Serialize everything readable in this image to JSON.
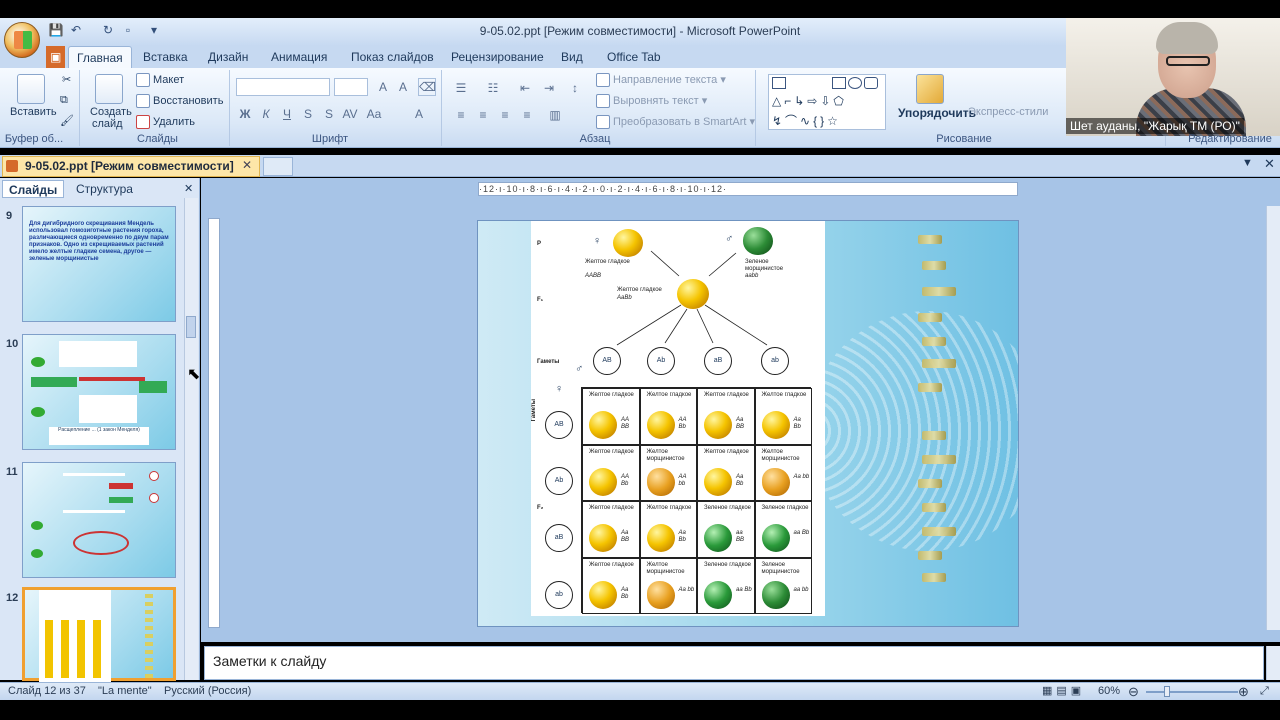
{
  "window": {
    "title": "9-05.02.ppt [Режим совместимости] - Microsoft PowerPoint"
  },
  "ribbon_tabs": [
    "Главная",
    "Вставка",
    "Дизайн",
    "Анимация",
    "Показ слайдов",
    "Рецензирование",
    "Вид",
    "Office Tab"
  ],
  "clipboard": {
    "paste": "Вставить",
    "label": "Буфер об..."
  },
  "slides_group": {
    "create": "Создать",
    "create2": "слайд",
    "layout": "Макет",
    "reset": "Восстановить",
    "delete": "Удалить",
    "label": "Слайды"
  },
  "font_group": {
    "label": "Шрифт"
  },
  "paragraph_group": {
    "direction": "Направление текста",
    "align": "Выровнять текст",
    "smartart": "Преобразовать в SmartArt",
    "label": "Абзац"
  },
  "drawing_group": {
    "arrange": "Упорядочить",
    "styles": "Экспресс-стили",
    "label": "Рисование"
  },
  "editing_group": {
    "label": "Редактирование"
  },
  "doc_tab": {
    "label": "9-05.02.ppt [Режим совместимости]"
  },
  "pane_tabs": {
    "slides": "Слайды",
    "outline": "Структура"
  },
  "thumbnails": [
    {
      "num": "9",
      "text": "Для дигибридного скрещивания Мендель использовал гомозиготные растения гороха, различающиеся одновременно по двум парам признаков. Одно из скрещиваемых растений имело желтые гладкие семена, другое — зеленые морщинистые"
    },
    {
      "num": "10",
      "caption": "Расщепление ... (1 закон Менделя)"
    },
    {
      "num": "11"
    },
    {
      "num": "12"
    }
  ],
  "ruler": {
    "h": "·12·ı·10·ı·8·ı·6·ı·4·ı·2·ı·0·ı·2·ı·4·ı·6·ı·8·ı·10·ı·12·"
  },
  "slide": {
    "p": "P",
    "f1": "F₁",
    "f2": "F₂",
    "gametes": "Гаметы",
    "gametes_v": "Гаметы",
    "parent1": "Желтое гладкое",
    "parent1_g": "AABB",
    "parent2": "Зеленое морщинистое",
    "parent2_g": "aabb",
    "f1_label": "Желтое гладкое",
    "f1_g": "AaBb",
    "gamete_list": [
      "AB",
      "Ab",
      "aB",
      "ab"
    ],
    "grid": [
      [
        {
          "l": "Желтое гладкое",
          "g": "AA BB",
          "t": "y"
        },
        {
          "l": "Желтое гладкое",
          "g": "AA Bb",
          "t": "y"
        },
        {
          "l": "Желтое гладкое",
          "g": "Aa BB",
          "t": "y"
        },
        {
          "l": "Желтое гладкое",
          "g": "Aa Bb",
          "t": "y"
        }
      ],
      [
        {
          "l": "Желтое гладкое",
          "g": "AA Bb",
          "t": "y"
        },
        {
          "l": "Желтое морщинистое",
          "g": "AA bb",
          "t": "yw"
        },
        {
          "l": "Желтое гладкое",
          "g": "Aa Bb",
          "t": "y"
        },
        {
          "l": "Желтое морщинистое",
          "g": "Aa bb",
          "t": "yw"
        }
      ],
      [
        {
          "l": "Желтое гладкое",
          "g": "Aa BB",
          "t": "y"
        },
        {
          "l": "Желтое гладкое",
          "g": "Aa Bb",
          "t": "y"
        },
        {
          "l": "Зеленое гладкое",
          "g": "aa BB",
          "t": "g"
        },
        {
          "l": "Зеленое гладкое",
          "g": "aa Bb",
          "t": "g"
        }
      ],
      [
        {
          "l": "Желтое гладкое",
          "g": "Aa Bb",
          "t": "y"
        },
        {
          "l": "Желтое морщинистое",
          "g": "Aa bb",
          "t": "yw"
        },
        {
          "l": "Зеленое гладкое",
          "g": "aa Bb",
          "t": "g"
        },
        {
          "l": "Зеленое морщинистое",
          "g": "aa bb",
          "t": "gw"
        }
      ]
    ]
  },
  "notes": {
    "placeholder": "Заметки к слайду"
  },
  "status": {
    "slide": "Слайд 12 из 37",
    "theme": "\"La mente\"",
    "lang": "Русский (Россия)",
    "zoom": "60%"
  },
  "webcam": {
    "name": "Шет ауданы, \"Жарық ТМ (РО)\""
  }
}
